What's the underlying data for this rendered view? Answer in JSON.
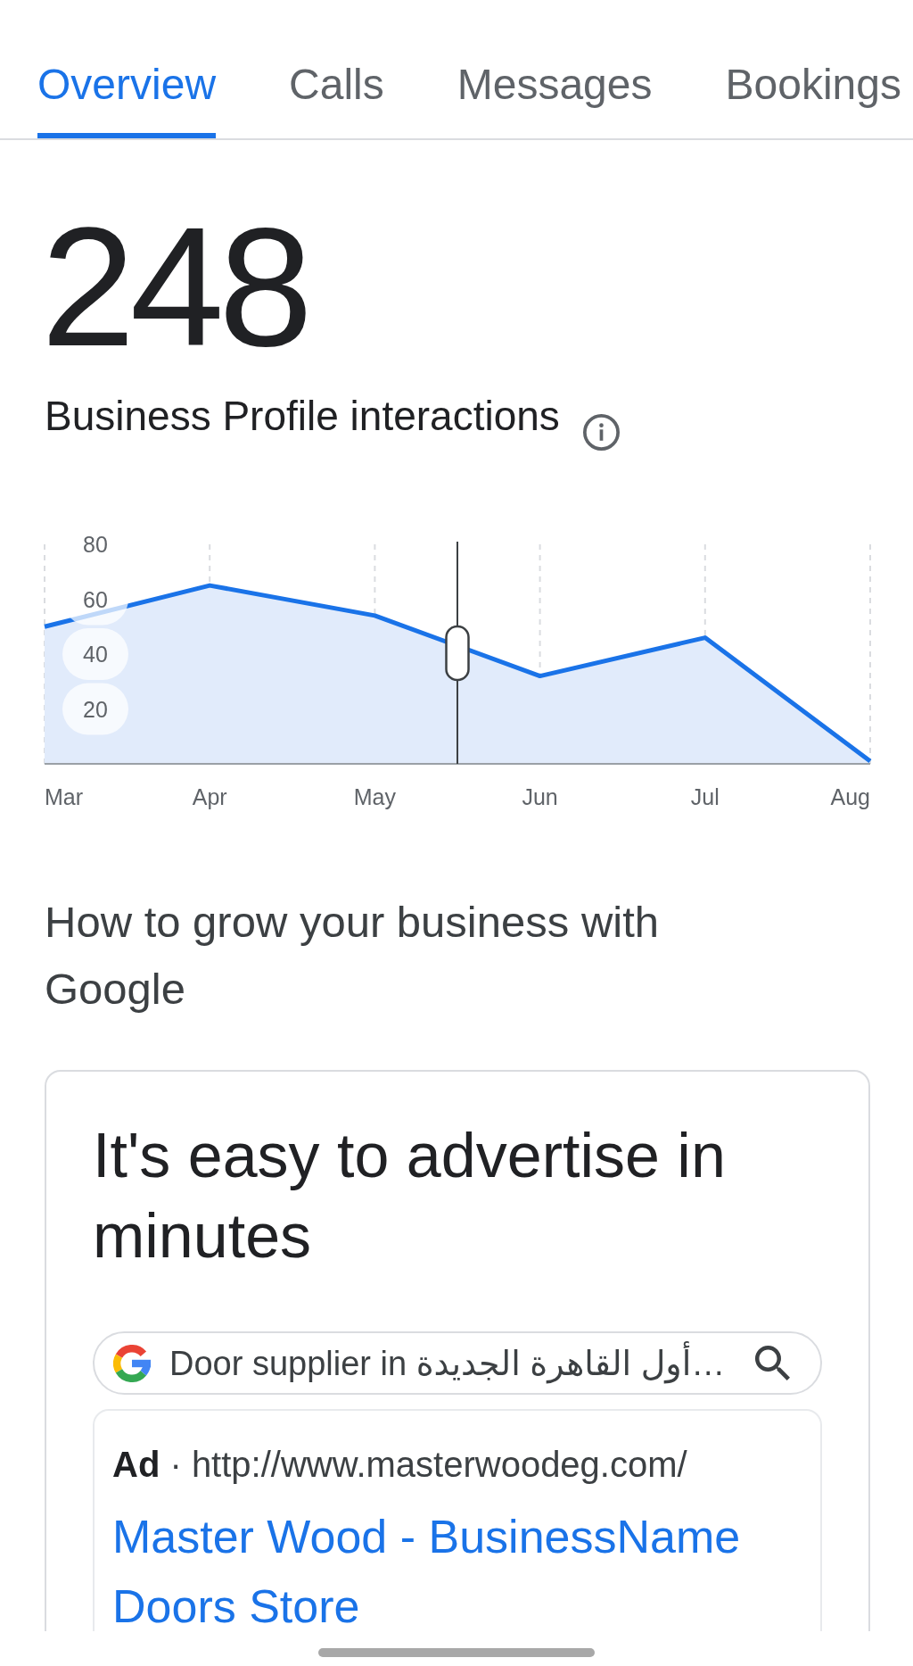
{
  "tabs": [
    {
      "label": "Overview",
      "selected": true
    },
    {
      "label": "Calls",
      "selected": false
    },
    {
      "label": "Messages",
      "selected": false
    },
    {
      "label": "Bookings",
      "selected": false
    }
  ],
  "summary": {
    "value": "248",
    "label": "Business Profile interactions"
  },
  "chart": {
    "chart_data": {
      "type": "area",
      "categories": [
        "Mar",
        "Apr",
        "May",
        "Jun",
        "Jul",
        "Aug"
      ],
      "values": [
        50,
        65,
        54,
        32,
        46,
        1
      ],
      "ylim": [
        0,
        80
      ],
      "yticks": [
        20,
        40,
        60,
        80
      ],
      "grid": true
    }
  },
  "promo": {
    "heading": "How to grow your business with Google",
    "card": {
      "title": "It's easy to advertise in minutes",
      "search": {
        "value": "Door supplier in أول القاهرة الجديدة…"
      },
      "ad": {
        "line": "**Ad** · http://www.masterwoodeg.com/",
        "title": "Master Wood - BusinessName Doors Store"
      }
    }
  }
}
